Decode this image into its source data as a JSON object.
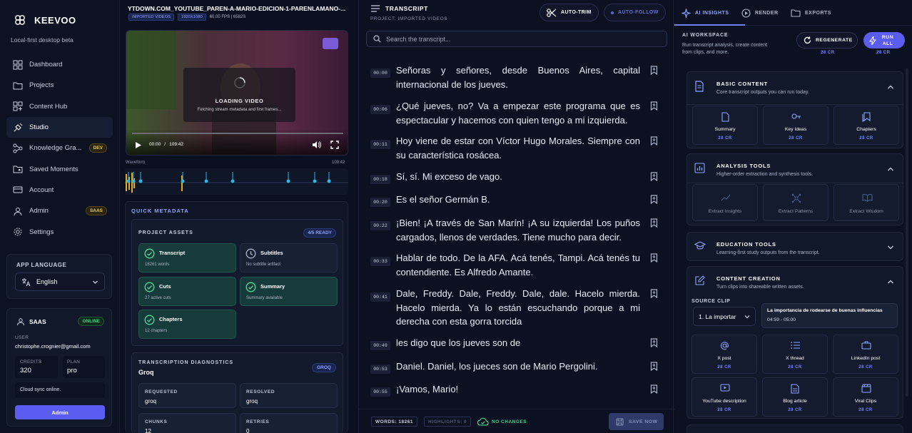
{
  "app": {
    "name": "KEEVOO",
    "tagline": "Local-first desktop beta"
  },
  "sidebar": {
    "items": [
      {
        "label": "Dashboard",
        "icon": "dashboard-icon"
      },
      {
        "label": "Projects",
        "icon": "folder-icon"
      },
      {
        "label": "Content Hub",
        "icon": "grid-icon"
      },
      {
        "label": "Studio",
        "icon": "studio-icon",
        "active": true
      },
      {
        "label": "Knowledge Gra...",
        "icon": "graph-icon",
        "badge": "DEV"
      },
      {
        "label": "Saved Moments",
        "icon": "bookmark-folder-icon"
      },
      {
        "label": "Account",
        "icon": "card-icon"
      },
      {
        "label": "Admin",
        "icon": "person-icon",
        "badge": "SAAS"
      },
      {
        "label": "Settings",
        "icon": "gear-icon"
      }
    ],
    "language": {
      "label": "APP LANGUAGE",
      "value": "English"
    },
    "saas": {
      "title": "SAAS",
      "status": "ONLINE",
      "user_label": "USER",
      "user": "christophe.crognier@gmail.com",
      "credits_label": "CREDITS",
      "credits": "320",
      "plan_label": "PLAN",
      "plan": "pro",
      "sync": "Cloud sync online.",
      "admin_button": "Admin"
    }
  },
  "video": {
    "file_title": "YTDOWN.COM_YOUTUBE_PAREN-A-MARIO-EDICION-1-PARENLAMANO-...",
    "chips": [
      "IMPORTED VIDEOS",
      "1920X1080"
    ],
    "meta": "60.00 FPS | 6582S",
    "loading_title": "LOADING VIDEO",
    "loading_sub": "Fetching stream metadata and first frames...",
    "time_current": "00:00",
    "time_sep": "/",
    "time_total": "109:42",
    "waveform_label": "Waveform",
    "waveform_end": "109:42",
    "progress": 0
  },
  "metadata": {
    "title": "QUICK METADATA",
    "assets_title": "PROJECT ASSETS",
    "ready": "4/5 READY",
    "assets": [
      {
        "title": "Transcript",
        "sub": "18261 words",
        "ok": true
      },
      {
        "title": "Subtitles",
        "sub": "No subtitle artifact",
        "ok": false
      },
      {
        "title": "Cuts",
        "sub": "27 active cuts",
        "ok": true
      },
      {
        "title": "Summary",
        "sub": "Summary available",
        "ok": true
      },
      {
        "title": "Chapters",
        "sub": "12 chapters",
        "ok": true
      }
    ],
    "diag_title": "TRANSCRIPTION DIAGNOSTICS",
    "diag_engine": "Groq",
    "diag_badge": "GROQ",
    "diag": [
      {
        "label": "REQUESTED",
        "value": "groq"
      },
      {
        "label": "RESOLVED",
        "value": "groq"
      },
      {
        "label": "CHUNKS",
        "value": "12"
      },
      {
        "label": "RETRIES",
        "value": "0"
      }
    ]
  },
  "transcript": {
    "title": "TRANSCRIPT",
    "subtitle": "PROJECT: IMPORTED VIDEOS",
    "auto_trim": "AUTO-TRIM",
    "auto_follow": "AUTO-FOLLOW",
    "search_placeholder": "Search the transcript...",
    "lines": [
      {
        "time": "00:00",
        "text": "Señoras y señores, desde Buenos Aires, capital internacional de los jueves."
      },
      {
        "time": "00:06",
        "text": "¿Qué jueves, no? Va a empezar este programa que es espectacular y hacemos con quien tengo a mi izquierda."
      },
      {
        "time": "00:11",
        "text": "Hoy viene de estar con Víctor Hugo Morales. Siempre con su característica rosácea."
      },
      {
        "time": "00:18",
        "text": "Sí, sí. Mi exceso de vago."
      },
      {
        "time": "00:20",
        "text": "Es el señor Germán B."
      },
      {
        "time": "00:22",
        "text": "¡Bien! ¡A través de San Marín! ¡A su izquierda! Los puños cargados, llenos de verdades. Tiene mucho para decir."
      },
      {
        "time": "00:33",
        "text": "Hablar de todo. De la AFA. Acá tenés, Tampi. Acá tenés tu contendiente. Es Alfredo Amante."
      },
      {
        "time": "00:41",
        "text": "Dale, Freddy. Dale, Freddy. Dale, dale. Hacelo mierda. Hacelo mierda. Ya lo están escuchando porque a mi derecha con esta gorra torcida"
      },
      {
        "time": "00:49",
        "text": "les digo que los jueves son de"
      },
      {
        "time": "00:53",
        "text": "Daniel. Daniel, los jueces son de Mario Pergolini."
      },
      {
        "time": "00:55",
        "text": "¡Vamos, Mario!"
      }
    ],
    "words": "WORDS: 18261",
    "highlights": "HIGHLIGHTS: 0",
    "changes": "NO CHANGES",
    "save": "SAVE NOW"
  },
  "ai": {
    "tabs": [
      "AI INSIGHTS",
      "RENDER",
      "EXPORTS"
    ],
    "workspace_title": "AI WORKSPACE",
    "workspace_desc": "Run transcript analysis, create content from clips, and more.",
    "regenerate": "REGENERATE",
    "regenerate_cost": "28 CR",
    "run_all": "RUN ALL",
    "run_all_cost": "28 CR",
    "sections": [
      {
        "title": "BASIC CONTENT",
        "desc": "Core transcript outputs you can run today.",
        "expanded": true
      },
      {
        "title": "ANALYSIS TOOLS",
        "desc": "Higher-order extraction and synthesis tools.",
        "expanded": true
      },
      {
        "title": "EDUCATION TOOLS",
        "desc": "Learning-first study outputs from the transcript.",
        "expanded": false
      },
      {
        "title": "CONTENT CREATION",
        "desc": "Turn clips into shareable written assets.",
        "expanded": true
      }
    ],
    "basic_tiles": [
      {
        "label": "Summary",
        "cost": "28 CR"
      },
      {
        "label": "Key Ideas",
        "cost": "28 CR"
      },
      {
        "label": "Chapters",
        "cost": "28 CR"
      }
    ],
    "analysis_tiles": [
      {
        "label": "Extract Insights"
      },
      {
        "label": "Extract Patterns"
      },
      {
        "label": "Extract Wisdom"
      }
    ],
    "source_clip_label": "SOURCE CLIP",
    "source_clip_value": "1. La importar",
    "clip_title": "La importancia de rodearse de buenas influencias",
    "clip_range": "04:59 - 05:00",
    "creation_tiles": [
      {
        "label": "X post",
        "cost": "28 CR"
      },
      {
        "label": "X thread",
        "cost": "28 CR"
      },
      {
        "label": "LinkedIn post",
        "cost": "28 CR"
      },
      {
        "label": "YouTube description",
        "cost": "28 CR"
      },
      {
        "label": "Blog article",
        "cost": "28 CR"
      },
      {
        "label": "Viral Clips",
        "cost": "28 CR"
      }
    ]
  },
  "colors": {
    "accent": "#5b5cf0",
    "success": "#3fd08a",
    "warning": "#e6c85a",
    "link": "#8ea4ff"
  }
}
